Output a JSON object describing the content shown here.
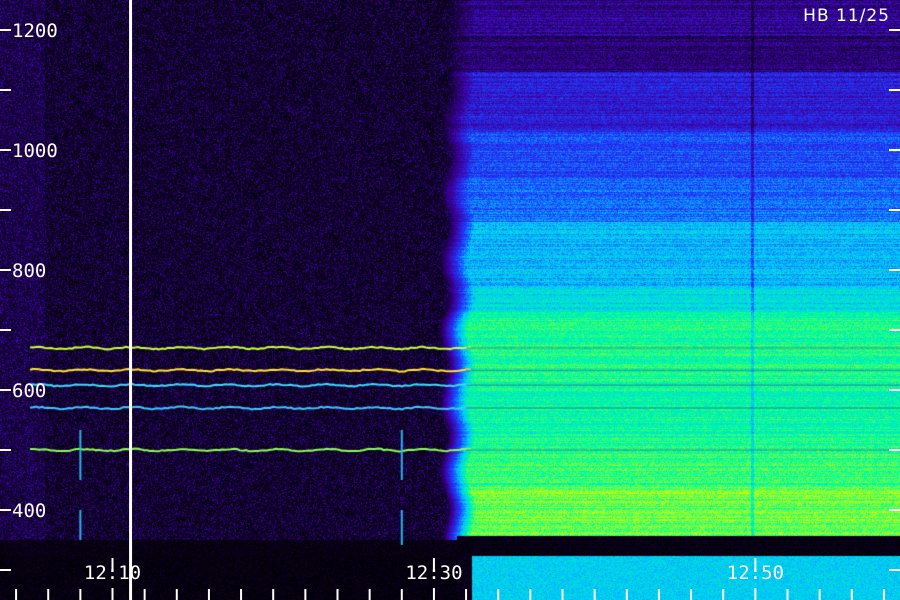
{
  "chart_data": {
    "type": "heatmap",
    "title": "",
    "xlabel": "",
    "ylabel": "",
    "annotation": "HB 11/25",
    "x_range": [
      "12:03",
      "12:59"
    ],
    "ylim": [
      250,
      1250
    ],
    "y_major_ticks": [
      400,
      600,
      800,
      1000,
      1200
    ],
    "y_minor_ticks": [
      300,
      500,
      700,
      900,
      1100
    ],
    "x_major_ticks": [
      "12:10",
      "12:30",
      "12:50"
    ],
    "x_minor_step_minutes": 2,
    "marker_line_time": "12:11",
    "emission_lines": [
      {
        "value": 670,
        "color": "#c8ff3c"
      },
      {
        "value": 633,
        "color": "#ffe632"
      },
      {
        "value": 608,
        "color": "#3cdcff"
      },
      {
        "value": 570,
        "color": "#3cc8ff"
      },
      {
        "value": 500,
        "color": "#8cff50"
      }
    ],
    "broadband_onset_time": "12:32",
    "colormap": [
      "#000000",
      "#3c00a0",
      "#1e3cff",
      "#00c8ff",
      "#00ff96",
      "#d2ff00"
    ]
  }
}
